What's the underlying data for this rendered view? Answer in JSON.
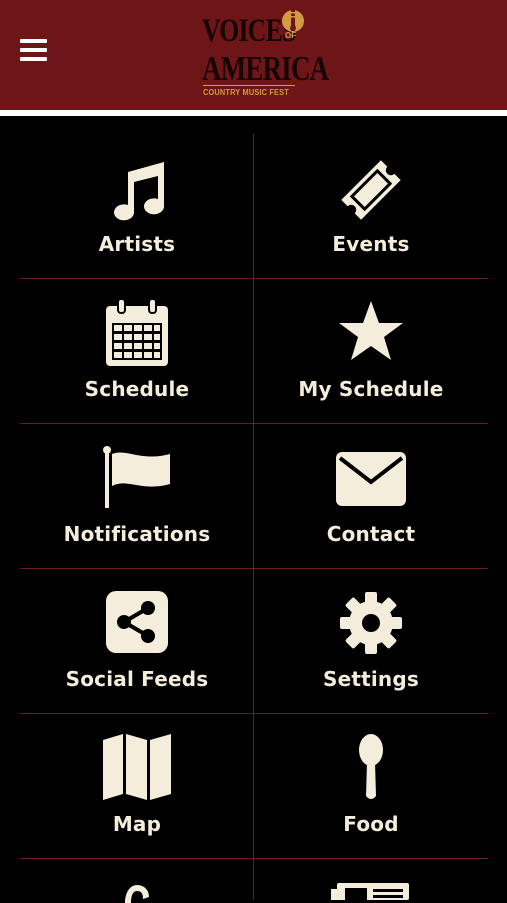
{
  "header": {
    "logo": {
      "line1": "VOICES",
      "of": "OF",
      "line2": "AMERICA",
      "tagline": "COUNTRY MUSIC FEST"
    },
    "menu_icon": "hamburger-menu-icon"
  },
  "colors": {
    "header_bg": "#6e1617",
    "page_bg": "#000000",
    "text": "#f4eddc",
    "divider": "#6b1e1d",
    "logo_gold": "#d39b43"
  },
  "tiles": [
    {
      "label": "Artists",
      "icon": "music-note-icon"
    },
    {
      "label": "Events",
      "icon": "ticket-icon"
    },
    {
      "label": "Schedule",
      "icon": "calendar-icon"
    },
    {
      "label": "My Schedule",
      "icon": "star-icon"
    },
    {
      "label": "Notifications",
      "icon": "flag-icon"
    },
    {
      "label": "Contact",
      "icon": "envelope-icon"
    },
    {
      "label": "Social Feeds",
      "icon": "share-icon"
    },
    {
      "label": "Settings",
      "icon": "gear-icon"
    },
    {
      "label": "Map",
      "icon": "map-icon"
    },
    {
      "label": "Food",
      "icon": "spoon-icon"
    },
    {
      "label": "",
      "icon": "question-icon"
    },
    {
      "label": "",
      "icon": "newspaper-icon"
    }
  ]
}
